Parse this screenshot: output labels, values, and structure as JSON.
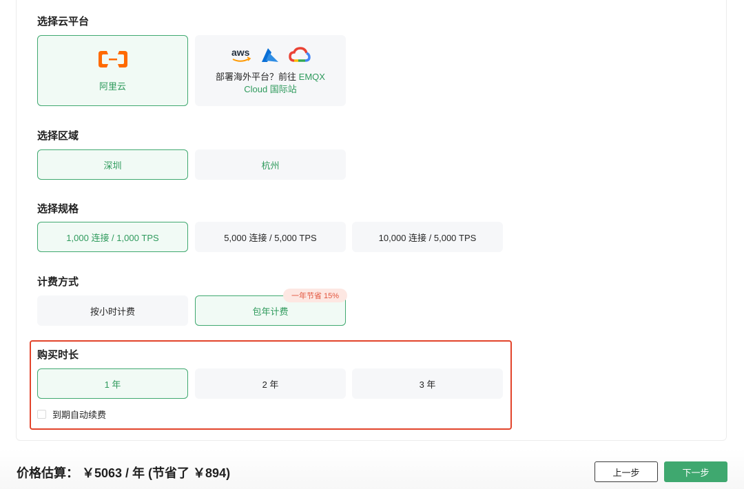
{
  "cloud": {
    "title": "选择云平台",
    "aliyun_label": "阿里云",
    "overseas_prefix": "部署海外平台？前往",
    "overseas_link": "EMQX Cloud 国际站",
    "aws_text": "aws"
  },
  "region": {
    "title": "选择区域",
    "options": [
      "深圳",
      "杭州"
    ],
    "selected": "深圳"
  },
  "spec": {
    "title": "选择规格",
    "options": [
      "1,000 连接 / 1,000 TPS",
      "5,000 连接 / 5,000 TPS",
      "10,000 连接 / 5,000 TPS"
    ],
    "selected": "1,000 连接 / 1,000 TPS"
  },
  "billing": {
    "title": "计费方式",
    "options": [
      "按小时计费",
      "包年计费"
    ],
    "selected": "包年计费",
    "badge": "一年节省 15%"
  },
  "duration": {
    "title": "购买时长",
    "options": [
      "1 年",
      "2 年",
      "3 年"
    ],
    "selected": "1 年",
    "auto_renew_label": "到期自动续费",
    "auto_renew_checked": false
  },
  "footer": {
    "price_text": "价格估算： ￥5063 / 年 (节省了 ￥894)",
    "prev_label": "上一步",
    "next_label": "下一步"
  },
  "colors": {
    "accent": "#3fa86f",
    "highlight_border": "#e2432a",
    "aliyun_orange": "#ff6a00"
  }
}
